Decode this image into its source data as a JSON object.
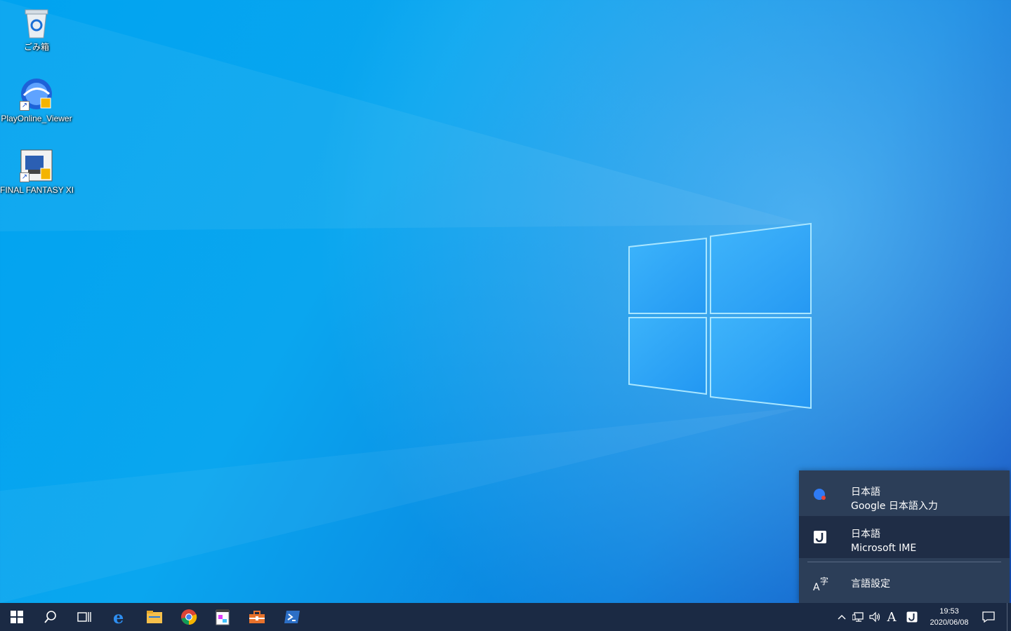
{
  "desktop": {
    "icons": [
      {
        "label": "ごみ箱",
        "icon": "recycle-bin-icon"
      },
      {
        "label": "PlayOnline_Viewer",
        "icon": "playonline-icon"
      },
      {
        "label": "FINAL FANTASY XI",
        "icon": "final-fantasy-icon"
      }
    ]
  },
  "ime_menu": {
    "items": [
      {
        "language": "日本語",
        "ime": "Google 日本語入力",
        "icon": "google-ime-icon"
      },
      {
        "language": "日本語",
        "ime": "Microsoft IME",
        "icon": "microsoft-ime-icon",
        "selected": true
      }
    ],
    "settings_label": "言語設定",
    "settings_icon": "language-settings-icon"
  },
  "taskbar": {
    "pinned": [
      {
        "icon": "start-icon"
      },
      {
        "icon": "search-icon"
      },
      {
        "icon": "task-view-icon"
      },
      {
        "icon": "edge-icon"
      },
      {
        "icon": "file-explorer-icon"
      },
      {
        "icon": "chrome-icon"
      },
      {
        "icon": "notepad-icon"
      },
      {
        "icon": "toolbox-icon"
      },
      {
        "icon": "powershell-icon"
      }
    ],
    "tray": {
      "ime_mode": "A",
      "time": "19:53",
      "date": "2020/06/08"
    }
  },
  "colors": {
    "taskbar": "#1b2a44",
    "popup": "#2c3e58",
    "popup_selected": "#1f2d46"
  }
}
